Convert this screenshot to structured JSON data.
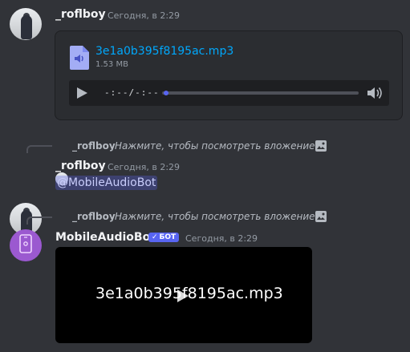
{
  "messages": [
    {
      "username": "_roflboy",
      "timestamp": "Сегодня, в 2:29",
      "attachment": {
        "file_name": "3e1a0b395f8195ac.mp3",
        "file_size": "1.53 MB",
        "time_display": "-:--/-:--",
        "progress": 0.02
      }
    },
    {
      "reply": {
        "username": "_roflboy",
        "text": "Нажмите, чтобы посмотреть вложение"
      },
      "username": "_roflboy",
      "timestamp": "Сегодня, в 2:29",
      "content_mention": "@MobileAudioBot"
    },
    {
      "reply": {
        "username": "_roflboy",
        "text": "Нажмите, чтобы посмотреть вложение"
      },
      "username": "MobileAudioBot",
      "badge": "БОТ",
      "badge_check": "✓",
      "timestamp": "Сегодня, в 2:29",
      "video": {
        "title": "3e1a0b395f8195ac.mp3"
      }
    }
  ],
  "colors": {
    "background": "#313338",
    "link": "#00a8fc",
    "accent": "#5865f2",
    "bot_avatar": "#9b59d0"
  },
  "icons": [
    "audio-file-icon",
    "play-icon",
    "volume-icon",
    "image-icon",
    "phone-icon",
    "checkmark-icon"
  ]
}
